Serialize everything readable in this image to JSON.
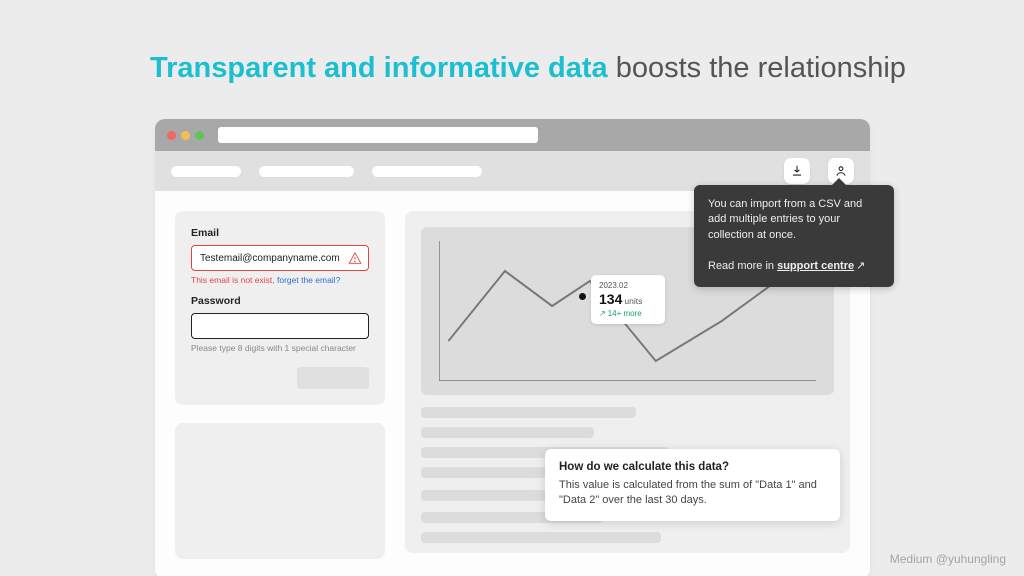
{
  "headline": {
    "highlight": "Transparent and informative data",
    "rest": " boosts the relationship"
  },
  "form": {
    "email_label": "Email",
    "email_value": "Testemail@companyname.com",
    "email_error_prefix": "This email is not exist, ",
    "email_error_link": "forget the email?",
    "password_label": "Password",
    "password_helper": "Please type 8 digits with 1 special character"
  },
  "chart_tooltip": {
    "date": "2023.02",
    "value": "134",
    "unit": "units",
    "trend": "14+ more"
  },
  "import_tooltip": {
    "body": "You can import from a CSV and add multiple entries to your collection at once.",
    "readmore_prefix": "Read more in ",
    "readmore_link": "support centre"
  },
  "info_popover": {
    "question": "How do we calculate this data?",
    "answer": "This value is calculated from the sum of \"Data 1\" and \"Data 2\" over the last 30 days."
  },
  "credit": "Medium @yuhungling",
  "chart_data": {
    "type": "line",
    "title": "",
    "xlabel": "",
    "ylabel": "",
    "x": [
      1,
      2,
      3,
      4,
      5,
      6,
      7
    ],
    "values": [
      60,
      130,
      95,
      134,
      40,
      70,
      120
    ],
    "highlighted_point": {
      "x": 4,
      "value": 134,
      "label": "2023.02",
      "unit": "units",
      "delta": "14+ more"
    }
  }
}
